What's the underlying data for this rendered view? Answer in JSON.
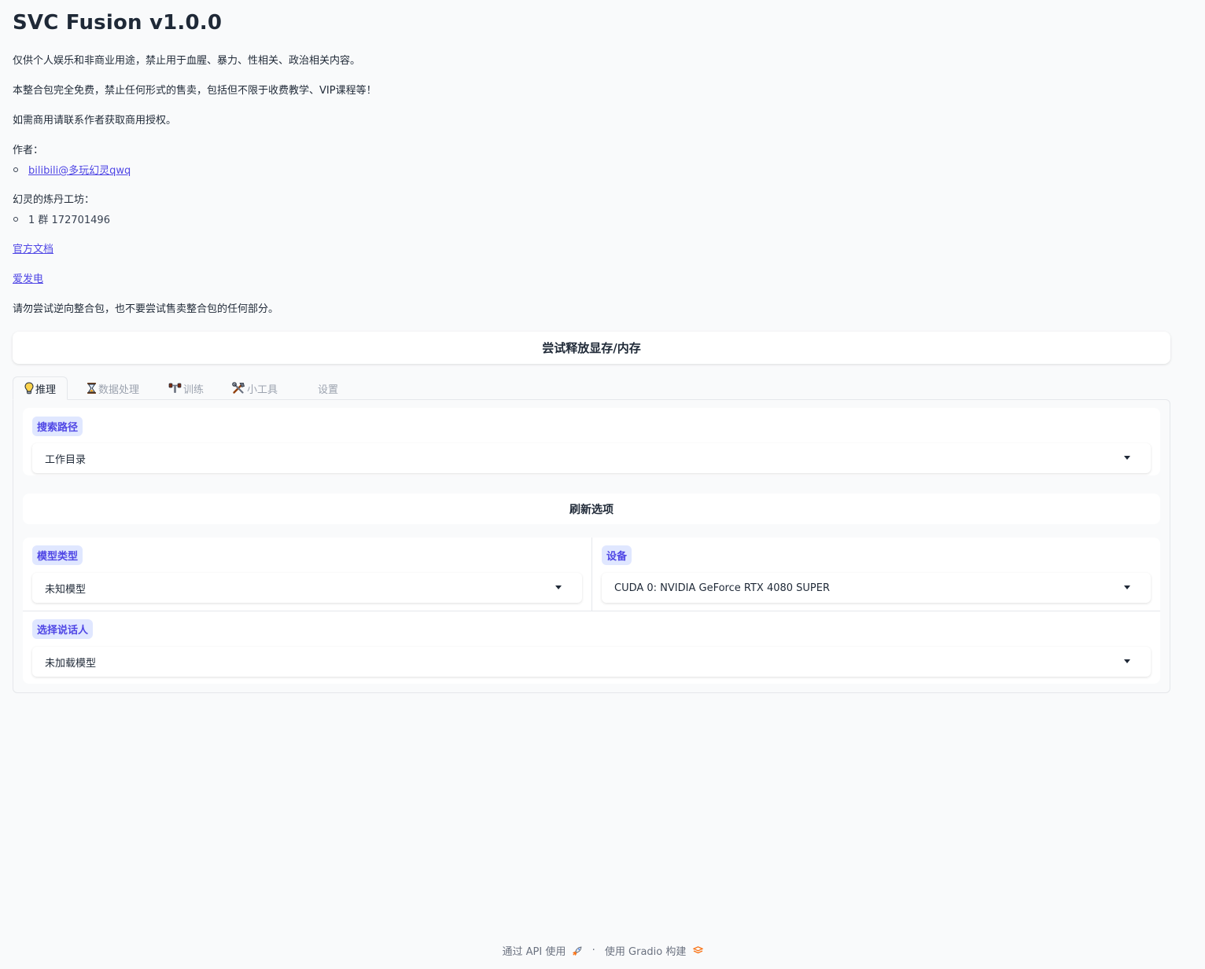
{
  "app": {
    "title": "SVC Fusion v1.0.0"
  },
  "intro": {
    "line1": "仅供个人娱乐和非商业用途，禁止用于血腥、暴力、性相关、政治相关内容。",
    "line2": "本整合包完全免费，禁止任何形式的售卖，包括但不限于收费教学、VIP课程等！",
    "line3": "如需商用请联系作者获取商用授权。",
    "author_label": "作者：",
    "author_link": "bilibili@多玩幻灵qwq",
    "group_label": "幻灵的炼丹工坊：",
    "group_item": "1 群 172701496",
    "docs_link": "官方文档",
    "afdian_link": "爱发电",
    "warning": "请勿尝试逆向整合包，也不要尝试售卖整合包的任何部分。"
  },
  "free_memory_button": "尝试释放显存/内存",
  "tabs": [
    {
      "label": "推理",
      "icon": "lightbulb-icon",
      "active": true
    },
    {
      "label": "数据处理",
      "icon": "hourglass-icon",
      "active": false
    },
    {
      "label": "训练",
      "icon": "dumbbell-icon",
      "active": false
    },
    {
      "label": "小工具",
      "icon": "tools-icon",
      "active": false
    },
    {
      "label": "设置",
      "icon": "",
      "active": false
    }
  ],
  "inference": {
    "search_path": {
      "label": "搜索路径",
      "value": "工作目录"
    },
    "refresh_button": "刷新选项",
    "model_type": {
      "label": "模型类型",
      "value": "未知模型"
    },
    "device": {
      "label": "设备",
      "value": "CUDA 0: NVIDIA GeForce RTX 4080 SUPER"
    },
    "speaker": {
      "label": "选择说话人",
      "value": "未加载模型"
    }
  },
  "footer": {
    "api": "通过 API 使用",
    "separator": "·",
    "built_with": "使用 Gradio 构建"
  },
  "colors": {
    "background": "#f9fafb",
    "accent": "#4f46e5",
    "badge_bg": "#e0e7ff",
    "gradio_orange": "#f97316"
  }
}
